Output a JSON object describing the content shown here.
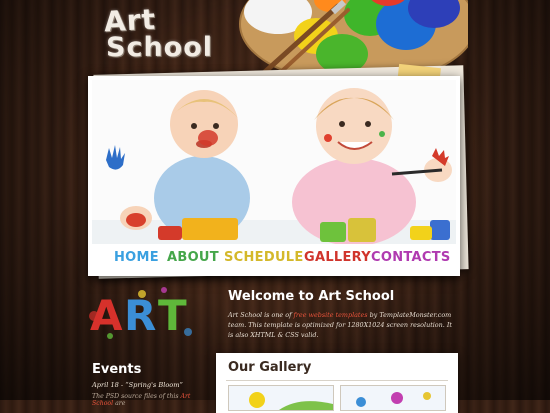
{
  "logo": {
    "line1": "Art",
    "line2": "School"
  },
  "nav": {
    "items": [
      {
        "label": "HOME",
        "color": "#3aa0e0"
      },
      {
        "label": "ABOUT",
        "color": "#45a64a"
      },
      {
        "label": "SCHEDULE",
        "color": "#d4b82a"
      },
      {
        "label": "GALLERY",
        "color": "#d0342c"
      },
      {
        "label": "CONTACTS",
        "color": "#b03ab0"
      }
    ]
  },
  "art_splash": {
    "letters": [
      "A",
      "R",
      "T"
    ],
    "colors": [
      "#d6312b",
      "#3b8ed6",
      "#5fb83a",
      "#e6c532",
      "#c23fb0"
    ]
  },
  "welcome": {
    "title": "Welcome to Art School",
    "text_pre": "Art School is one of ",
    "text_link": "free website templates",
    "text_post": " by TemplateMonster.com team. This template is optimized for 1280X1024 screen resolution. It is also XHTML & CSS valid."
  },
  "events": {
    "title": "Events",
    "date": "April 18 - “Spring's Bloom”",
    "text_pre": "The PSD source files of this ",
    "text_link": "Art School",
    "text_post": " are"
  },
  "gallery": {
    "title": "Our Gallery"
  },
  "colors": {
    "accent_link": "#e8533b",
    "wood_dark": "#2a1810",
    "frame": "#ffffff"
  }
}
